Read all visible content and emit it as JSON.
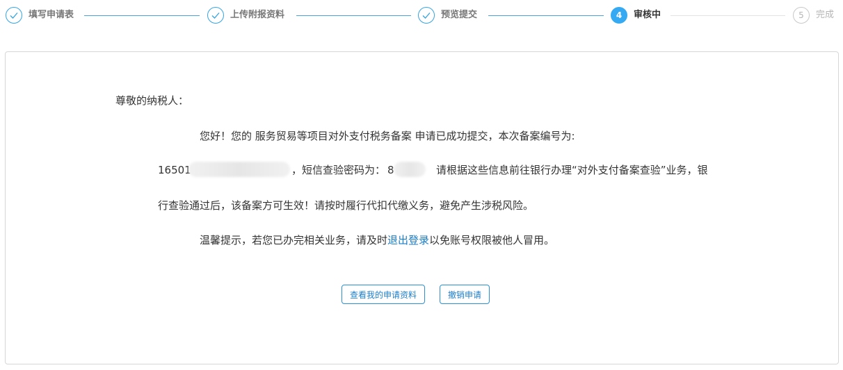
{
  "steps": [
    {
      "number": "1",
      "label": "填写申请表",
      "state": "done"
    },
    {
      "number": "2",
      "label": "上传附报资料",
      "state": "done"
    },
    {
      "number": "3",
      "label": "预览提交",
      "state": "done"
    },
    {
      "number": "4",
      "label": "审核中",
      "state": "active"
    },
    {
      "number": "5",
      "label": "完成",
      "state": "pending"
    }
  ],
  "message": {
    "greeting": "尊敬的纳税人：",
    "line1": "您好！您的 服务贸易等项目对外支付税务备案 申请已成功提交，本次备案编号为:",
    "filing_number_prefix": "16501",
    "sms_label": "，短信查验密码为：",
    "sms_code_prefix": "8",
    "line2_rest": "请根据这些信息前往银行办理“对外支付备案查验”业务，银",
    "line3": "行查验通过后，该备案方可生效！请按时履行代扣代缴义务，避免产生涉税风险。",
    "tip_before": "温馨提示，若您已办完相关业务，请及时",
    "logout_link": "退出登录",
    "tip_after": "以免账号权限被他人冒用。"
  },
  "buttons": {
    "view_application": "查看我的申请资料",
    "cancel_application": "撤销申请"
  },
  "colors": {
    "accent": "#35aaf2",
    "link": "#1a7bc9",
    "border": "#d6d6d6"
  }
}
